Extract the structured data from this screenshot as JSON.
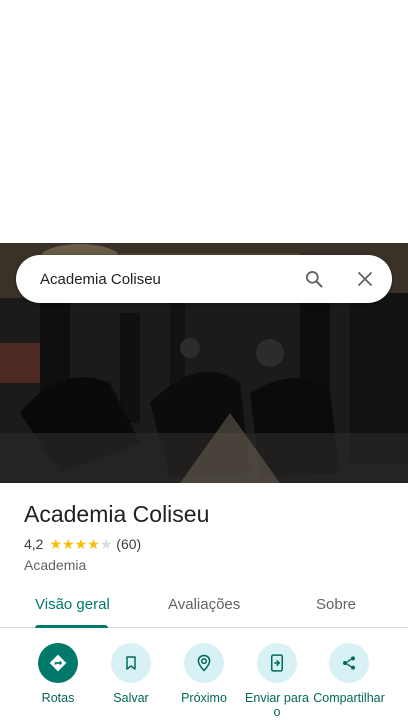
{
  "search": {
    "value": "Academia Coliseu"
  },
  "place": {
    "name": "Academia Coliseu",
    "rating": "4,2",
    "stars": 4,
    "reviews": "(60)",
    "category": "Academia"
  },
  "tabs": [
    {
      "label": "Visão geral"
    },
    {
      "label": "Avaliações"
    },
    {
      "label": "Sobre"
    }
  ],
  "actions": [
    {
      "label": "Rotas",
      "icon": "directions-icon"
    },
    {
      "label": "Salvar",
      "icon": "bookmark-icon"
    },
    {
      "label": "Próximo",
      "icon": "nearby-icon"
    },
    {
      "label": "Enviar para o",
      "icon": "send-to-phone-icon"
    },
    {
      "label": "Compartilhar",
      "icon": "share-icon"
    }
  ],
  "colors": {
    "accent": "#00796b",
    "star": "#fbbc04",
    "chip": "#d7f1f5"
  }
}
